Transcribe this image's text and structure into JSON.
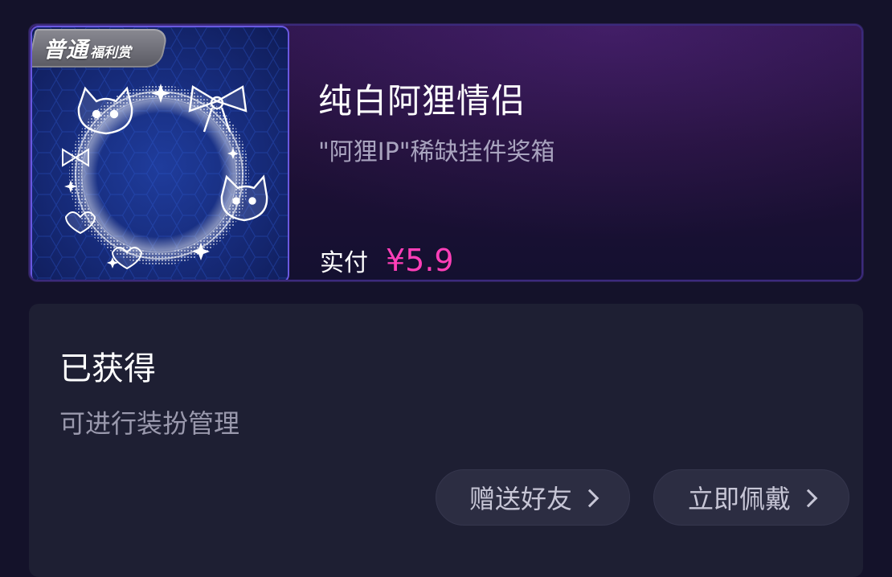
{
  "product": {
    "badge_main": "普通",
    "badge_sub": "福利赏",
    "title": "纯白阿狸情侣",
    "subtitle": "\"阿狸IP\"稀缺挂件奖箱",
    "price_label": "实付",
    "price_value": "¥5.9",
    "image_icon": "ahri-frame-ring-icon"
  },
  "status": {
    "title": "已获得",
    "description": "可进行装扮管理",
    "buttons": {
      "gift_label": "赠送好友",
      "wear_label": "立即佩戴"
    }
  },
  "colors": {
    "background": "#14122a",
    "price_accent": "#ff3fb8",
    "card_border": "#3b2a7c",
    "thumb_border": "#6a58e0",
    "status_card": "#1e1f33",
    "button_bg": "#2c2d42"
  }
}
